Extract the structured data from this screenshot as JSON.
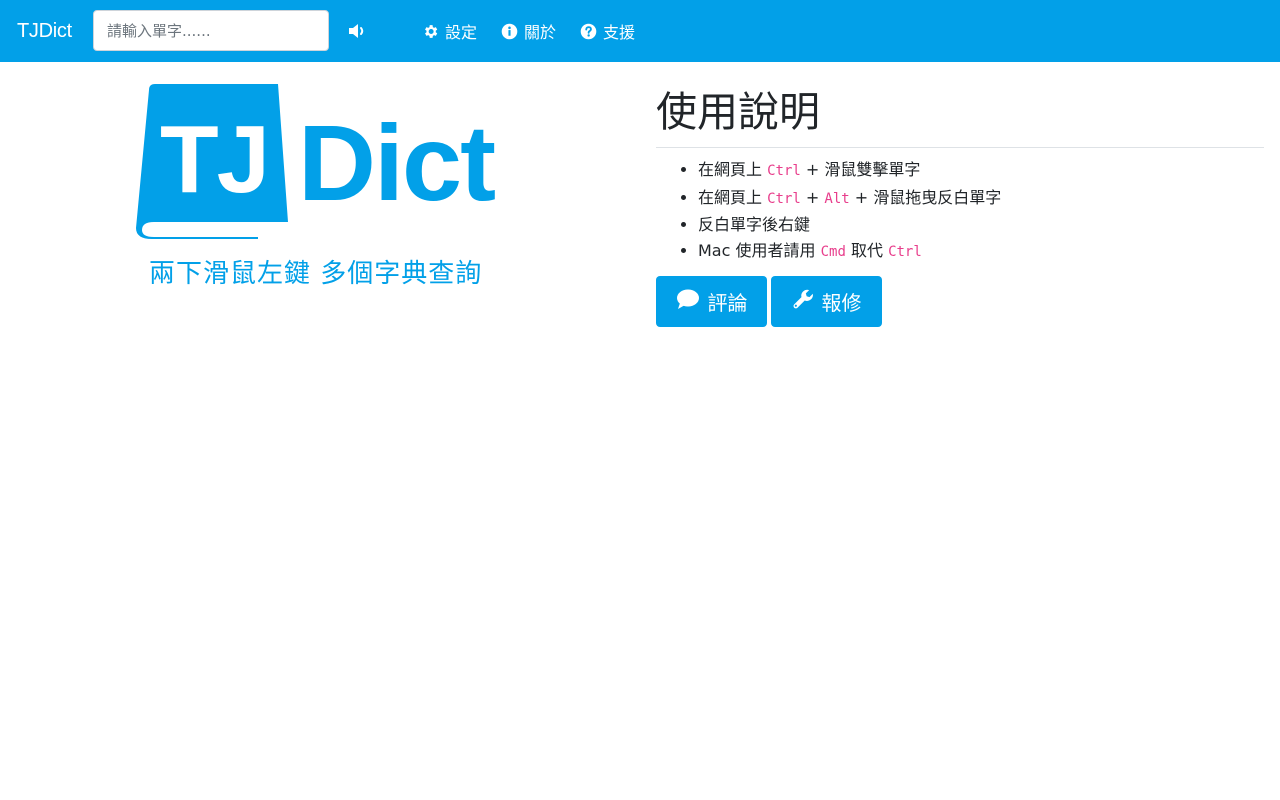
{
  "navbar": {
    "brand": "TJDict",
    "search_placeholder": "請輸入單字......",
    "search_value": "",
    "items": [
      {
        "label": "設定",
        "icon": "gear-icon"
      },
      {
        "label": "關於",
        "icon": "info-icon"
      },
      {
        "label": "支援",
        "icon": "question-icon"
      }
    ],
    "speaker_icon": "speaker-icon"
  },
  "logo": {
    "tj": "TJ",
    "dict": "Dict",
    "tagline": "兩下滑鼠左鍵 多個字典查詢"
  },
  "usage": {
    "title": "使用說明",
    "items": [
      {
        "before": "在網頁上 ",
        "code1": "Ctrl",
        "mid": " + 滑鼠雙擊單字",
        "code2": "",
        "after": ""
      },
      {
        "before": "在網頁上 ",
        "code1": "Ctrl",
        "mid": " + ",
        "code2": "Alt",
        "after": " + 滑鼠拖曳反白單字"
      },
      {
        "before": "反白單字後右鍵",
        "code1": "",
        "mid": "",
        "code2": "",
        "after": ""
      },
      {
        "before": "Mac 使用者請用 ",
        "code1": "Cmd",
        "mid": " 取代 ",
        "code2": "Ctrl",
        "after": ""
      }
    ]
  },
  "buttons": {
    "comment": "評論",
    "report": "報修"
  },
  "colors": {
    "brand": "#02a0e8",
    "code": "#e83e8c"
  }
}
